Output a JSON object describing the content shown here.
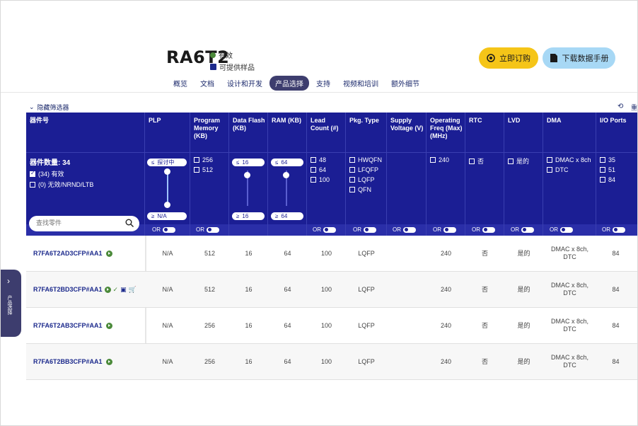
{
  "product": {
    "title": "RA6T2",
    "status": "有效",
    "availability": "可提供样品"
  },
  "actions": {
    "order_label": "立即订购",
    "datasheet_label": "下载数据手册"
  },
  "nav": {
    "tabs": [
      "概览",
      "文档",
      "设计和开发",
      "产品选择",
      "支持",
      "视频和培训",
      "额外细节"
    ],
    "active": "产品选择"
  },
  "filters": {
    "toggle_label": "隐藏筛选器",
    "reset_label": "重",
    "headers": {
      "part": "器件号",
      "plp": "PLP",
      "program_memory": "Program Memory (KB)",
      "data_flash": "Data Flash (KB)",
      "ram": "RAM (KB)",
      "lead_count": "Lead Count (#)",
      "pkg_type": "Pkg. Type",
      "supply_voltage": "Supply Voltage (V)",
      "operating_freq": "Operating Freq (Max) (MHz)",
      "rtc": "RTC",
      "lvd": "LVD",
      "dma": "DMA",
      "io_ports": "I/O Ports"
    },
    "part_count": "器件数量: 34",
    "status_options": [
      "(34) 有效",
      "(0) 无效/NRND/LTB"
    ],
    "search_placeholder": "查找零件",
    "plp_max": "探讨中",
    "plp_min": "N/A",
    "data_flash_max": "16",
    "data_flash_min": "16",
    "ram_max": "64",
    "ram_min": "64",
    "le": "≤",
    "ge": "≥",
    "program_memory_options": [
      "256",
      "512"
    ],
    "lead_count_options": [
      "48",
      "64",
      "100"
    ],
    "pkg_type_options": [
      "HWQFN",
      "LFQFP",
      "LQFP",
      "QFN"
    ],
    "operating_freq_options": [
      "240"
    ],
    "rtc_options": [
      "否"
    ],
    "lvd_options": [
      "是的"
    ],
    "dma_options": [
      "DMAC x 8ch",
      "DTC"
    ],
    "io_ports_options": [
      "35",
      "51",
      "84"
    ],
    "or_label": "OR"
  },
  "rows": [
    {
      "part": "R7FA6T2AD3CFP#AA1",
      "plp": "N/A",
      "pm": "512",
      "df": "16",
      "ram": "64",
      "lead": "100",
      "pkg": "LQFP",
      "freq": "240",
      "rtc": "否",
      "lvd": "是的",
      "dma": "DMAC x 8ch, DTC",
      "io": "84",
      "extra_icons": false
    },
    {
      "part": "R7FA6T2BD3CFP#AA1",
      "plp": "N/A",
      "pm": "512",
      "df": "16",
      "ram": "64",
      "lead": "100",
      "pkg": "LQFP",
      "freq": "240",
      "rtc": "否",
      "lvd": "是的",
      "dma": "DMAC x 8ch, DTC",
      "io": "84",
      "extra_icons": true
    },
    {
      "part": "R7FA6T2AB3CFP#AA1",
      "plp": "N/A",
      "pm": "256",
      "df": "16",
      "ram": "64",
      "lead": "100",
      "pkg": "LQFP",
      "freq": "240",
      "rtc": "否",
      "lvd": "是的",
      "dma": "DMAC x 8ch, DTC",
      "io": "84",
      "extra_icons": false
    },
    {
      "part": "R7FA6T2BB3CFP#AA1",
      "plp": "N/A",
      "pm": "256",
      "df": "16",
      "ram": "64",
      "lead": "100",
      "pkg": "LQFP",
      "freq": "240",
      "rtc": "否",
      "lvd": "是的",
      "dma": "DMAC x 8ch, DTC",
      "io": "84",
      "extra_icons": false
    }
  ],
  "side_tab": {
    "label": "产品选择"
  }
}
